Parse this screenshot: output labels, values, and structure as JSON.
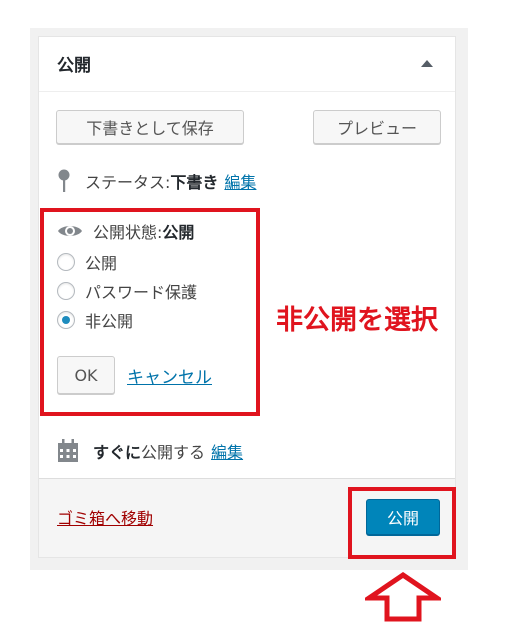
{
  "box": {
    "title": "公開",
    "draft_button": "下書きとして保存",
    "preview_button": "プレビュー",
    "status": {
      "label": "ステータス: ",
      "value": "下書き",
      "edit": "編集"
    },
    "visibility": {
      "label": "公開状態: ",
      "value": "公開",
      "options": [
        "公開",
        "パスワード保護",
        "非公開"
      ],
      "selected": "非公開",
      "ok": "OK",
      "cancel": "キャンセル"
    },
    "schedule": {
      "prefix": "すぐに",
      "label": "公開する",
      "edit": "編集"
    },
    "trash": "ゴミ箱へ移動",
    "publish_button": "公開"
  },
  "annotation": {
    "text": "非公開を選択",
    "color": "#e0141e"
  },
  "icons": [
    "chevron-up-icon",
    "pin-icon",
    "eye-icon",
    "calendar-icon",
    "up-arrow-icon"
  ],
  "colors": {
    "primary": "#0085ba",
    "link": "#0073aa",
    "trash": "#a00000"
  }
}
